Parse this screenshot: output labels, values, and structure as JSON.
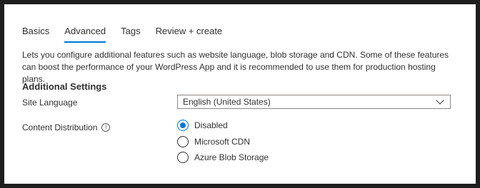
{
  "tabs": [
    {
      "label": "Basics",
      "active": false
    },
    {
      "label": "Advanced",
      "active": true
    },
    {
      "label": "Tags",
      "active": false
    },
    {
      "label": "Review + create",
      "active": false
    }
  ],
  "description": "Lets you configure additional features such as website language, blob storage and CDN. Some of these features can boost the performance of your WordPress App and it is recommended to use them for production hosting plans.",
  "section_title": "Additional Settings",
  "site_language": {
    "label": "Site Language",
    "value": "English (United States)"
  },
  "content_distribution": {
    "label": "Content Distribution",
    "info_icon": "info-icon",
    "options": [
      {
        "label": "Disabled",
        "checked": true
      },
      {
        "label": "Microsoft CDN",
        "checked": false
      },
      {
        "label": "Azure Blob Storage",
        "checked": false
      }
    ]
  },
  "colors": {
    "accent": "#0078d4",
    "text": "#323130",
    "border": "#8a8886"
  }
}
